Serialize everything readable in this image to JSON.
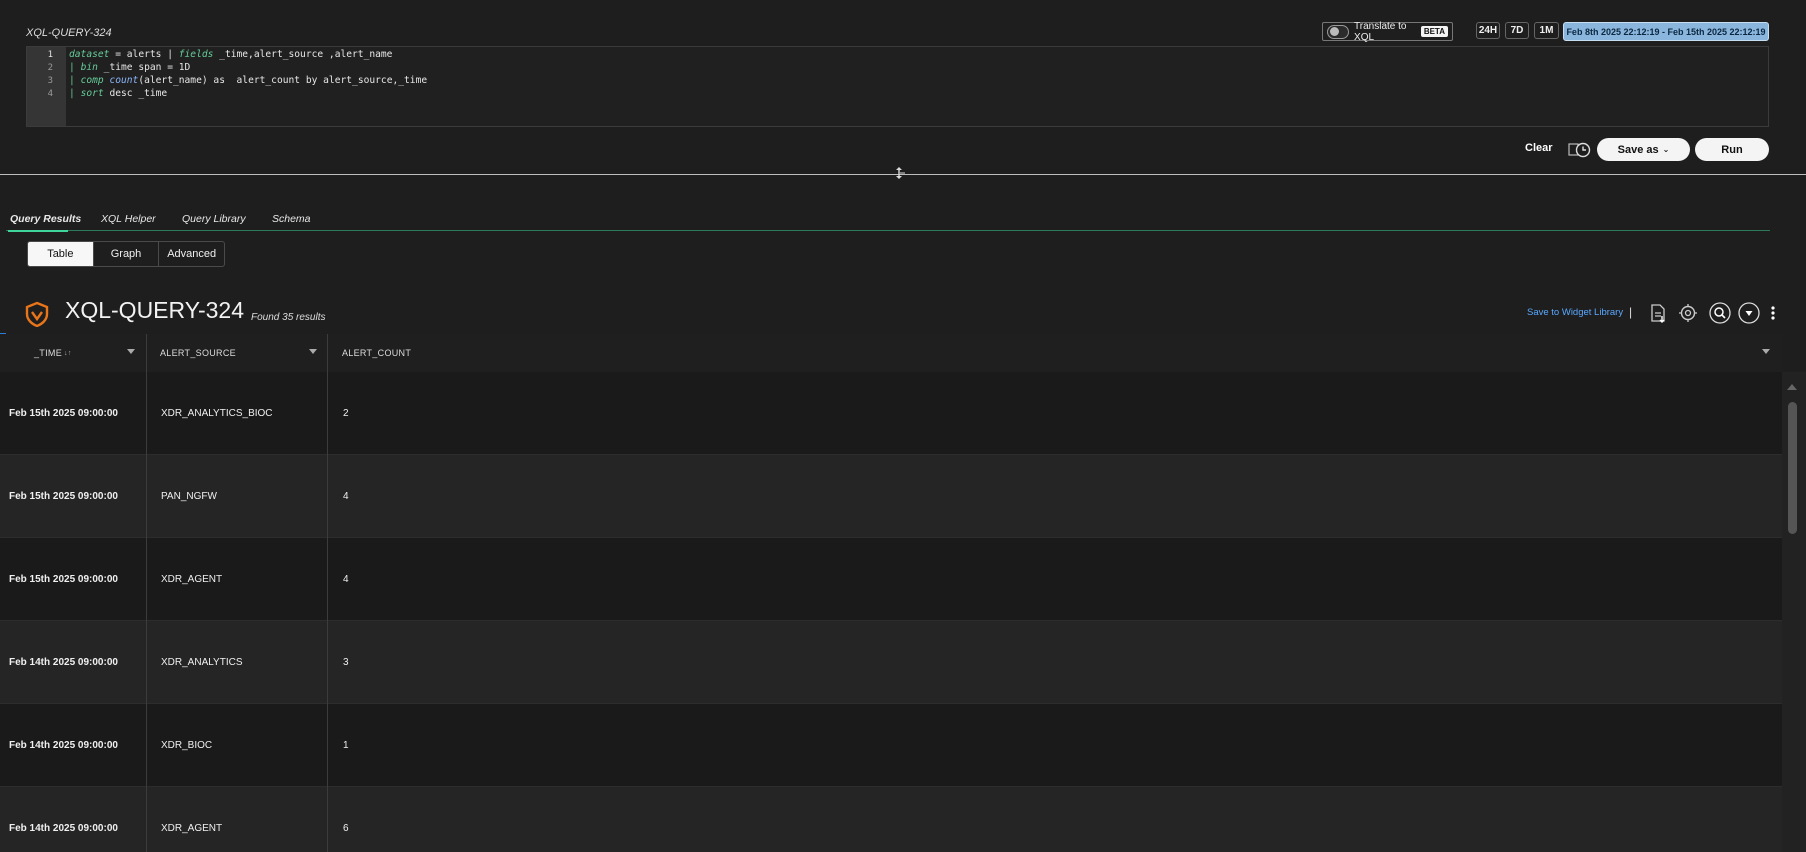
{
  "query": {
    "title": "XQL-QUERY-324",
    "translate_label": "Translate to XQL",
    "beta_label": "BETA",
    "ranges": [
      "24H",
      "7D",
      "1M"
    ],
    "date_range": "Feb 8th 2025 22:12:19 - Feb 15th 2025 22:12:19",
    "lines": [
      {
        "num": "1"
      },
      {
        "num": "2"
      },
      {
        "num": "3"
      },
      {
        "num": "4"
      }
    ],
    "code": {
      "l1_kw1": "dataset",
      "l1_t1": " = alerts | ",
      "l1_kw2": "fields",
      "l1_t2": " _time,alert_source ,alert_name",
      "l2_t0": "| ",
      "l2_kw": "bin",
      "l2_t1": " _time span = 1D",
      "l3_t0": "| ",
      "l3_kw": "comp",
      "l3_fn": " count",
      "l3_t1": "(alert_name) as  alert_count by alert_source,_time",
      "l4_t0": "| ",
      "l4_kw": "sort",
      "l4_t1": " desc _time"
    }
  },
  "actions": {
    "clear": "Clear",
    "save_as": "Save as",
    "run": "Run"
  },
  "tabs": [
    "Query Results",
    "XQL Helper",
    "Query Library",
    "Schema"
  ],
  "view_modes": [
    "Table",
    "Graph",
    "Advanced"
  ],
  "results": {
    "title": "XQL-QUERY-324",
    "found": "Found 35 results",
    "save_widget": "Save to Widget Library",
    "separator": "|"
  },
  "table": {
    "columns": [
      "_TIME",
      "ALERT_SOURCE",
      "ALERT_COUNT"
    ],
    "sort_glyph": "↓↑",
    "rows": [
      {
        "time": "Feb 15th 2025 09:00:00",
        "source": "XDR_ANALYTICS_BIOC",
        "count": "2"
      },
      {
        "time": "Feb 15th 2025 09:00:00",
        "source": "PAN_NGFW",
        "count": "4"
      },
      {
        "time": "Feb 15th 2025 09:00:00",
        "source": "XDR_AGENT",
        "count": "4"
      },
      {
        "time": "Feb 14th 2025 09:00:00",
        "source": "XDR_ANALYTICS",
        "count": "3"
      },
      {
        "time": "Feb 14th 2025 09:00:00",
        "source": "XDR_BIOC",
        "count": "1"
      },
      {
        "time": "Feb 14th 2025 09:00:00",
        "source": "XDR_AGENT",
        "count": "6"
      }
    ]
  },
  "colors": {
    "accent_green": "#3fd59a",
    "link_blue": "#5aa8ff",
    "date_range_bg": "#8ab6dd",
    "shield_orange": "#e8751a"
  }
}
